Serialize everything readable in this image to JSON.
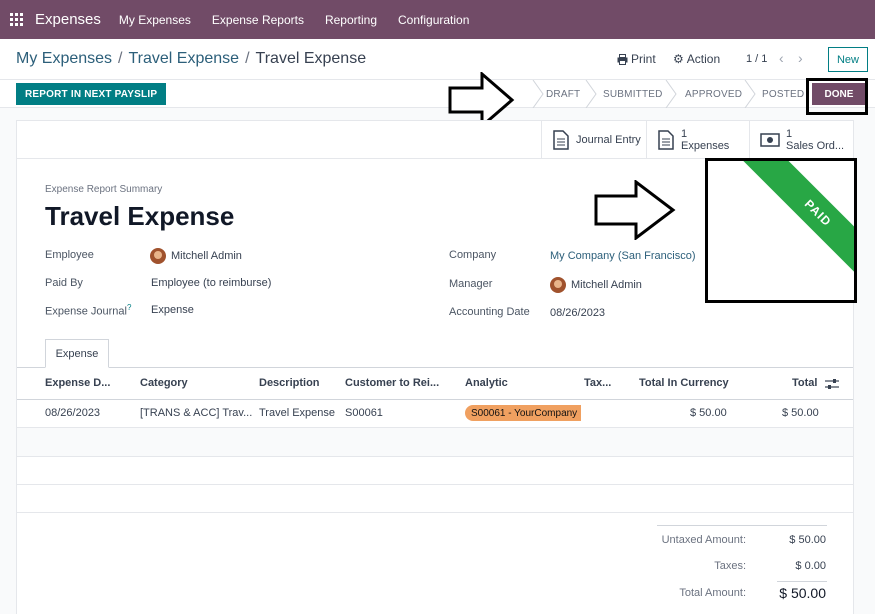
{
  "navbar": {
    "app_name": "Expenses",
    "menu": [
      "My Expenses",
      "Expense Reports",
      "Reporting",
      "Configuration"
    ]
  },
  "control": {
    "breadcrumb": [
      "My Expenses",
      "Travel Expense",
      "Travel Expense"
    ],
    "print_label": "Print",
    "action_label": "Action",
    "pager": "1 / 1",
    "new_label": "New"
  },
  "statusbar": {
    "report_button": "REPORT IN NEXT PAYSLIP",
    "stages": [
      "DRAFT",
      "SUBMITTED",
      "APPROVED",
      "POSTED",
      "DONE"
    ],
    "active_stage": "DONE"
  },
  "smart_buttons": {
    "journal_entry": "Journal Entry",
    "expenses_count": "1",
    "expenses_label": "Expenses",
    "sales_count": "1",
    "sales_label": "Sales Ord..."
  },
  "form": {
    "summary_label": "Expense Report Summary",
    "title": "Travel Expense",
    "employee_label": "Employee",
    "employee_value": "Mitchell Admin",
    "paid_by_label": "Paid By",
    "paid_by_value": "Employee (to reimburse)",
    "journal_label": "Expense Journal",
    "journal_help": "?",
    "journal_value": "Expense",
    "company_label": "Company",
    "company_value": "My Company (San Francisco)",
    "manager_label": "Manager",
    "manager_value": "Mitchell Admin",
    "acc_date_label": "Accounting Date",
    "acc_date_value": "08/26/2023",
    "ribbon": "PAID"
  },
  "tab": {
    "label": "Expense"
  },
  "table": {
    "headers": [
      "Expense D...",
      "Category",
      "Description",
      "Customer to Rei...",
      "Analytic",
      "Tax...",
      "Total In Currency",
      "Total"
    ],
    "rows": [
      {
        "date": "08/26/2023",
        "category": "[TRANS & ACC] Trav...",
        "description": "Travel Expense",
        "customer": "S00061",
        "analytic": "S00061 - YourCompany",
        "total_currency": "$ 50.00",
        "total": "$ 50.00"
      }
    ]
  },
  "totals": {
    "untaxed_label": "Untaxed Amount:",
    "untaxed_value": "$ 50.00",
    "taxes_label": "Taxes:",
    "taxes_value": "$ 0.00",
    "total_label": "Total Amount:",
    "total_value": "$ 50.00"
  },
  "colors": {
    "brand": "#714b67",
    "primary": "#017e84",
    "paid_ribbon": "#28a745",
    "analytic_tag": "#f0a060"
  }
}
